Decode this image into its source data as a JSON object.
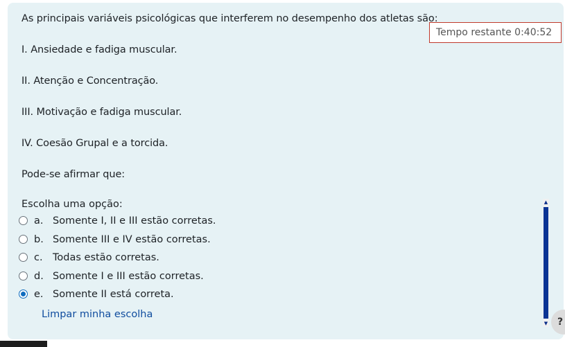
{
  "question": {
    "intro": "As principais variáveis psicológicas que interferem no desempenho dos atletas são:",
    "statements": [
      "I. Ansiedade e fadiga muscular.",
      "II. Atenção e Concentração.",
      "III. Motivação e fadiga muscular.",
      "IV. Coesão Grupal e a torcida."
    ],
    "conclusion": "Pode-se afirmar que:"
  },
  "timer": {
    "text": "Tempo restante 0:40:52"
  },
  "answer": {
    "prompt": "Escolha uma opção:",
    "options": [
      {
        "letter": "a.",
        "text": "Somente I, II e III estão corretas.",
        "selected": false
      },
      {
        "letter": "b.",
        "text": "Somente III e IV estão corretas.",
        "selected": false
      },
      {
        "letter": "c.",
        "text": "Todas estão corretas.",
        "selected": false
      },
      {
        "letter": "d.",
        "text": "Somente I e III estão corretas.",
        "selected": false
      },
      {
        "letter": "e.",
        "text": "Somente II está correta.",
        "selected": true
      }
    ],
    "clear_label": "Limpar minha escolha"
  },
  "help": {
    "label": "?"
  },
  "colors": {
    "card_background": "#e6f2f5",
    "link": "#0f4c9e",
    "radio_selected": "#0f6cbf",
    "timer_border": "#c0392b",
    "scroll_thumb": "#0b3494"
  }
}
